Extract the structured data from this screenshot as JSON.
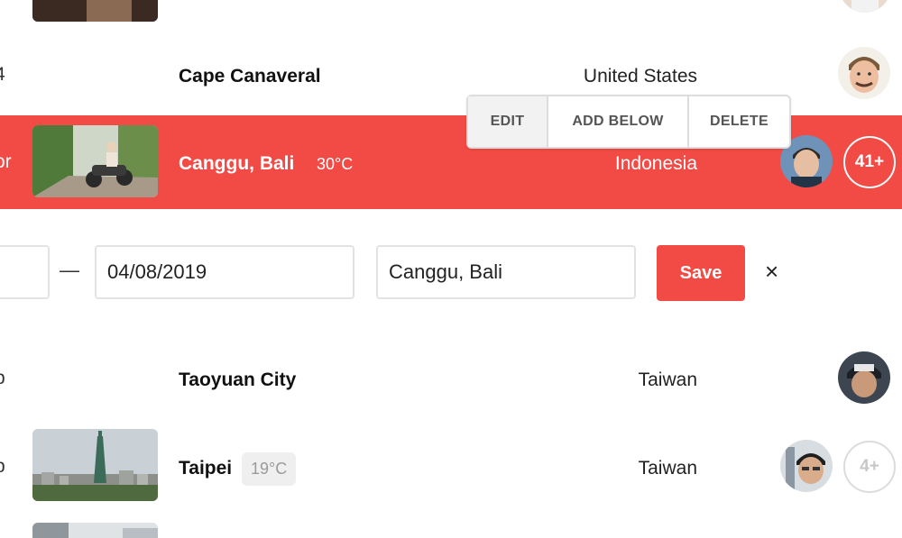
{
  "rows": [
    {
      "prefix": "",
      "city": "",
      "temp": "",
      "country": ""
    },
    {
      "prefix": "4",
      "city": "Cape Canaveral",
      "temp": "",
      "country": "United States"
    },
    {
      "prefix": "or",
      "city": "Canggu, Bali",
      "temp": "30°C",
      "country": "Indonesia",
      "badge": "41+"
    },
    {
      "prefix": "b",
      "city": "Taoyuan City",
      "temp": "",
      "country": "Taiwan"
    },
    {
      "prefix": "b",
      "city": "Taipei",
      "temp": "19°C",
      "country": "Taiwan",
      "badge": "4+"
    }
  ],
  "context_menu": {
    "edit": "EDIT",
    "add_below": "ADD BELOW",
    "delete": "DELETE"
  },
  "edit_form": {
    "date_separator": "—",
    "end_date": "04/08/2019",
    "location": "Canggu, Bali",
    "save_label": "Save",
    "close_symbol": "×"
  },
  "colors": {
    "accent": "#f24a45",
    "highlight_text": "#ffffff"
  }
}
